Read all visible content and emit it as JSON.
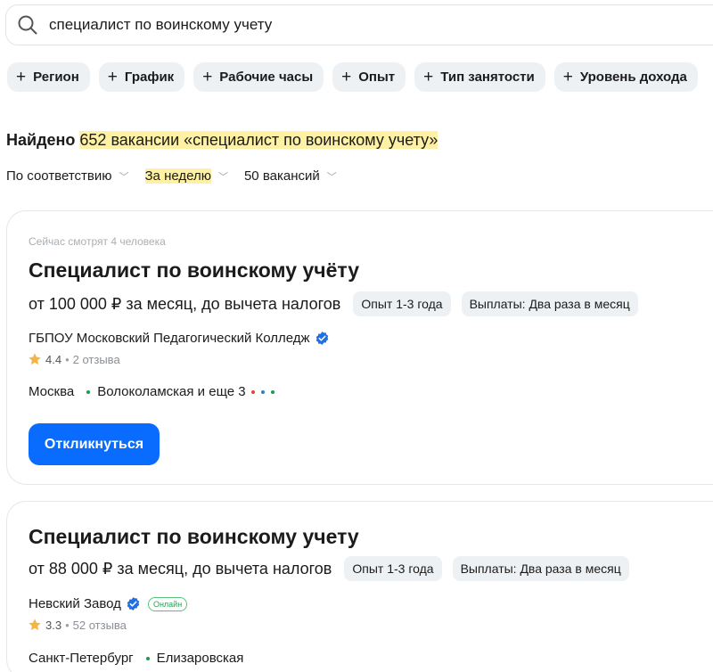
{
  "search": {
    "query": "специалист по воинскому учету"
  },
  "filters": [
    "Регион",
    "График",
    "Рабочие часы",
    "Опыт",
    "Тип занятости",
    "Уровень дохода"
  ],
  "results": {
    "found_prefix": "Найдено",
    "found_text": "652 вакансии «специалист по воинскому учету»"
  },
  "sort": {
    "order": "По соответствию",
    "period": "За неделю",
    "per_page": "50 вакансий"
  },
  "vacancies": [
    {
      "watching": "Сейчас смотрят 4 человека",
      "title": "Специалист по воинскому учёту",
      "salary": "от 100 000 ₽ за месяц, до вычета налогов",
      "experience": "Опыт 1-3 года",
      "payouts": "Выплаты: Два раза в месяц",
      "company": "ГБПОУ Московский Педагогический Колледж",
      "rating": "4.4",
      "reviews": "2 отзыва",
      "city": "Москва",
      "metro": "Волоколамская и еще 3",
      "metro_colors": [
        "#1a9c50",
        "#e4413b",
        "#2a82c9",
        "#1a9c50"
      ],
      "apply_label": "Откликнуться"
    },
    {
      "title": "Специалист по воинскому учету",
      "salary": "от 88 000 ₽ за месяц, до вычета налогов",
      "experience": "Опыт 1-3 года",
      "payouts": "Выплаты: Два раза в месяц",
      "company": "Невский Завод",
      "online_badge": "Онлайн",
      "rating": "3.3",
      "reviews": "52 отзыва",
      "city": "Санкт-Петербург",
      "metro": "Елизаровская",
      "metro_colors": [
        "#1a9c50"
      ]
    }
  ],
  "colors": {
    "accent": "#0a6cff",
    "highlight": "#fff1a3",
    "chip_bg": "#eef1f4",
    "verified": "#1f6fe5",
    "star": "#f4b446"
  }
}
